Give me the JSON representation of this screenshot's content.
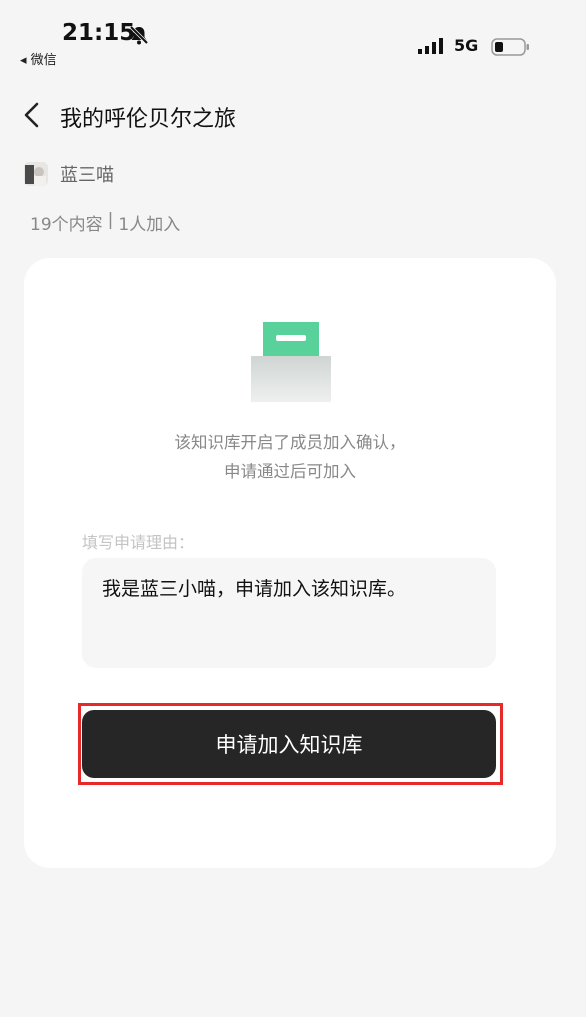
{
  "status_bar": {
    "time": "21:15",
    "back_app": "◂ 微信",
    "network": "5G"
  },
  "header": {
    "title": "我的呼伦贝尔之旅"
  },
  "author": {
    "name": "蓝三喵"
  },
  "stats": {
    "contents": "19个内容",
    "separator": "|",
    "members": "1人加入"
  },
  "card": {
    "notice_line1": "该知识库开启了成员加入确认，",
    "notice_line2": "申请通过后可加入",
    "reason_label": "填写申请理由：",
    "reason_text": "我是蓝三小喵，申请加入该知识库。",
    "join_button_label": "申请加入知识库"
  },
  "colors": {
    "accent_green": "#3cc98a",
    "button_dark": "#262626",
    "highlight_red": "#e62a2a"
  }
}
